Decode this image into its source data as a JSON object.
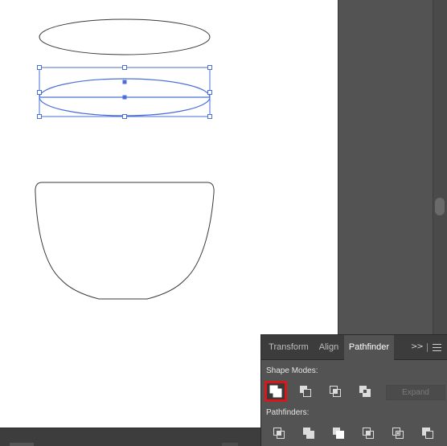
{
  "panel": {
    "tabs": [
      {
        "label": "Transform",
        "active": false
      },
      {
        "label": "Align",
        "active": false
      },
      {
        "label": "Pathfinder",
        "active": true
      }
    ],
    "more_glyph": ">>",
    "shape_modes_label": "Shape Modes:",
    "pathfinders_label": "Pathfinders:",
    "expand_label": "Expand",
    "shape_mode_buttons": [
      "unite-icon",
      "minus-front-icon",
      "intersect-icon",
      "exclude-icon"
    ],
    "pathfinder_buttons": [
      "divide-icon",
      "trim-icon",
      "merge-icon",
      "crop-icon",
      "outline-icon",
      "minus-back-icon"
    ],
    "highlight_color": "#d9161a"
  },
  "canvas": {
    "selection_color": "#4a6fd8",
    "path_color": "#3a3a3a"
  }
}
